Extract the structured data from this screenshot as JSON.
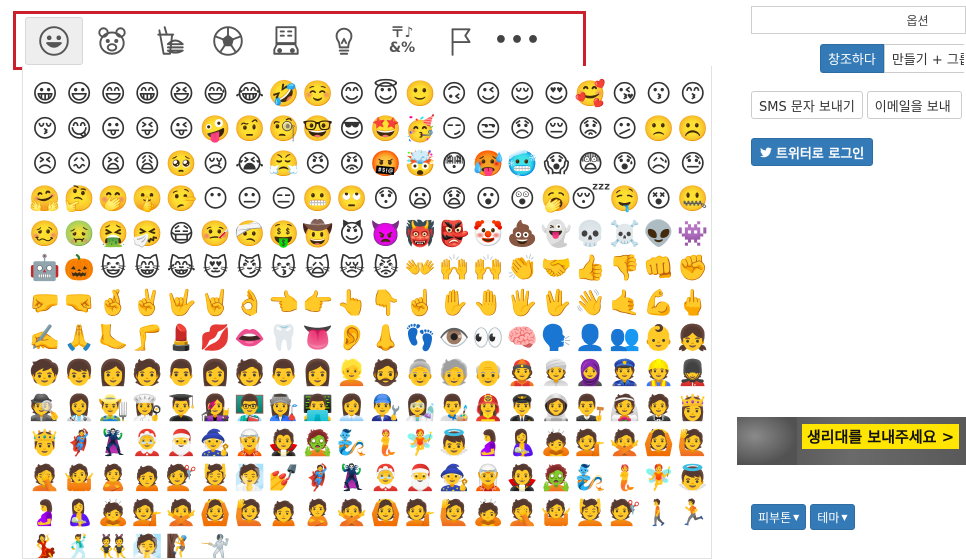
{
  "category_tabs": [
    {
      "name": "smileys",
      "icon": "smiley-icon",
      "active": true
    },
    {
      "name": "animals",
      "icon": "bear-icon",
      "active": false
    },
    {
      "name": "food",
      "icon": "burger-drink-icon",
      "active": false
    },
    {
      "name": "activity",
      "icon": "soccer-ball-icon",
      "active": false
    },
    {
      "name": "travel",
      "icon": "building-car-icon",
      "active": false
    },
    {
      "name": "objects",
      "icon": "lightbulb-icon",
      "active": false
    },
    {
      "name": "symbols",
      "icon": "symbols-icon",
      "symbol_top": "〒♪",
      "symbol_bottom": "&%",
      "active": false
    },
    {
      "name": "flags",
      "icon": "flag-icon",
      "active": false
    },
    {
      "name": "more",
      "icon": "more-dots-icon",
      "label": "•••",
      "active": false
    }
  ],
  "emoji_rows": [
    [
      "😀",
      "😃",
      "😄",
      "😁",
      "😆",
      "😅",
      "😂",
      "🤣",
      "☺️",
      "😊",
      "😇",
      "🙂",
      "🙃",
      "😉",
      "😌",
      "😍",
      "🥰",
      "😘",
      "😗"
    ],
    [
      "😙",
      "😚",
      "😋",
      "😛",
      "😝",
      "😜",
      "🤪",
      "🤨",
      "🧐",
      "🤓",
      "😎",
      "🤩",
      "🥳",
      "😏",
      "😒",
      "😞",
      "😔",
      "😟",
      "😕"
    ],
    [
      "🙁",
      "☹️",
      "😣",
      "😖",
      "😫",
      "😩",
      "🥺",
      "😢",
      "😭",
      "😤",
      "😠",
      "😡",
      "🤬",
      "🤯",
      "😳",
      "🥵",
      "🥶",
      "😱",
      "😨"
    ],
    [
      "😰",
      "😥",
      "😓",
      "🤗",
      "🤔",
      "🤭",
      "🤫",
      "🤥",
      "😶",
      "😐",
      "😑",
      "😬",
      "🙄",
      "😯",
      "😦",
      "😧",
      "😮",
      "😲",
      "🥱"
    ],
    [
      "😴",
      "🤤",
      "😵",
      "🤐",
      "🥴",
      "🤢",
      "🤮",
      "🤧",
      "😷",
      "🤒",
      "🤕",
      "🤑",
      "🤠",
      "😈",
      "👿",
      "👹",
      "👺",
      "🤡",
      "💩"
    ],
    [
      "👻",
      "💀",
      "☠️",
      "👽",
      "👾",
      "🤖",
      "🎃",
      "😺",
      "😸",
      "😹",
      "😻",
      "😼",
      "😽",
      "🙀",
      "😿",
      "😾",
      "👐",
      "🙌",
      "🙌"
    ],
    [
      "👏",
      "🤝",
      "👍",
      "👎",
      "👊",
      "✊",
      "🤛",
      "🤜",
      "🤞",
      "✌️",
      "🤟",
      "🤘",
      "👌",
      "👈",
      "👉",
      "👆",
      "👇",
      "☝️",
      "✋"
    ],
    [
      "🤚",
      "🖐️",
      "🖖",
      "👋",
      "🤙",
      "💪",
      "🖕",
      "✍️",
      "🙏",
      "🦶",
      "🦵",
      "💄",
      "💋",
      "👄",
      "🦷",
      "👅",
      "👂",
      "👃",
      "👣"
    ],
    [
      "👁️",
      "👀",
      "🧠",
      "🗣️",
      "👤",
      "👥",
      "👶",
      "👧",
      "🧒",
      "👦",
      "👩",
      "🧑",
      "👨",
      "👩",
      "🧑",
      "👨",
      "👩",
      "👱",
      "🧔"
    ],
    [
      "👵",
      "🧓",
      "👴",
      "👲",
      "👳",
      "🧕",
      "👮",
      "👷",
      "💂",
      "🕵️",
      "👩‍⚕️",
      "👨‍🌾",
      "👩‍🍳",
      "👨‍🎓",
      "👩‍🎤",
      "👨‍🏫",
      "👩‍🏭",
      "👨‍💻",
      "👩‍💼"
    ],
    [
      "👨‍🔧",
      "👩‍🔬",
      "👨‍🎨",
      "👩‍🚒",
      "👨‍✈️",
      "👩‍🚀",
      "👨‍⚖️",
      "👰",
      "🤵",
      "👸",
      "🤴",
      "🦸",
      "🦹",
      "🤶",
      "🎅",
      "🧙",
      "🧝",
      "🧛",
      "🧟"
    ],
    [
      "🧞",
      "🧜",
      "🧚",
      "👼",
      "🤰",
      "🤱",
      "🙇",
      "💁",
      "🙅",
      "🙆",
      "🙋",
      "🤦",
      "🤷",
      "🙎",
      "🙍",
      "💇",
      "💆",
      "🧖",
      "💅"
    ],
    [
      "🦸",
      "🦹",
      "🤶",
      "🎅",
      "🧙",
      "🧝",
      "🧛",
      "🧟",
      "🧞",
      "🧜",
      "🧚",
      "👼",
      "🤰",
      "🤱",
      "🙇",
      "💁",
      "🙅",
      "🙆",
      "🙋"
    ],
    [
      "🙍",
      "🙎",
      "🙅",
      "🙆",
      "💁",
      "🙋",
      "🙇",
      "🤦",
      "🤷",
      "💆",
      "💇",
      "🚶",
      "🏃",
      "💃",
      "🕺",
      "👯",
      "🧖",
      "🧗",
      "🤺"
    ]
  ],
  "right": {
    "option_label": "옵션",
    "create_button": "창조하다",
    "make_button": "만들기 + 그룹",
    "sms_button": "SMS 문자 보내기",
    "email_button": "이메일을 보내",
    "twitter_button": "트위터로 로그인",
    "banner_text": "생리대를 보내주세요 >",
    "skin_button": "피부톤",
    "theme_button": "테마"
  },
  "colors": {
    "highlight_border": "#cc1f2e",
    "primary": "#337ab7",
    "banner_yellow": "#ffe500"
  }
}
